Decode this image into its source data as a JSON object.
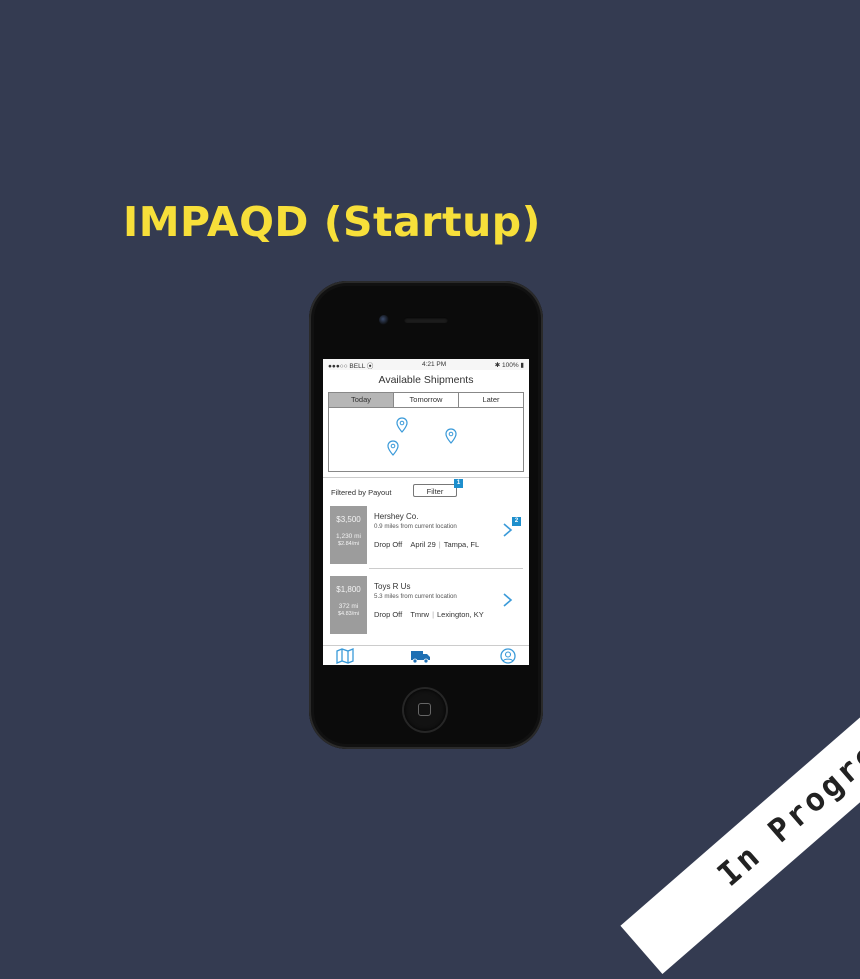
{
  "headline": "IMPAQD (Startup)",
  "ribbon": "In Progress",
  "colors": {
    "background": "#343b51",
    "headline": "#f7df3a",
    "accent": "#1e8fcd"
  },
  "status_bar": {
    "carrier": "●●●○○ BELL ⦿",
    "time": "4:21 PM",
    "battery": "✱ 100% ▮"
  },
  "screen": {
    "title": "Available Shipments",
    "tabs": [
      {
        "label": "Today",
        "active": true
      },
      {
        "label": "Tomorrow",
        "active": false
      },
      {
        "label": "Later",
        "active": false
      }
    ],
    "map_pins": [
      "map-pin-icon",
      "map-pin-icon",
      "map-pin-icon"
    ],
    "filter_label": "Filtered by Payout",
    "filter_button": "Filter",
    "filter_badge": "1",
    "shipments": [
      {
        "price": "$3,500",
        "miles": "1,230 mi",
        "rate": "$2.84/mi",
        "company": "Hershey Co.",
        "distance": "0.9 miles from current location",
        "drop_label": "Drop Off",
        "date": "April 29",
        "location": "Tampa, FL",
        "badge": "2"
      },
      {
        "price": "$1,800",
        "miles": "372 mi",
        "rate": "$4.83/mi",
        "company": "Toys R Us",
        "distance": "5.3 miles from current location",
        "drop_label": "Drop Off",
        "date": "Tmrw",
        "location": "Lexington, KY"
      }
    ],
    "tab_bar": [
      "map-icon",
      "truck-icon",
      "profile-icon"
    ]
  }
}
